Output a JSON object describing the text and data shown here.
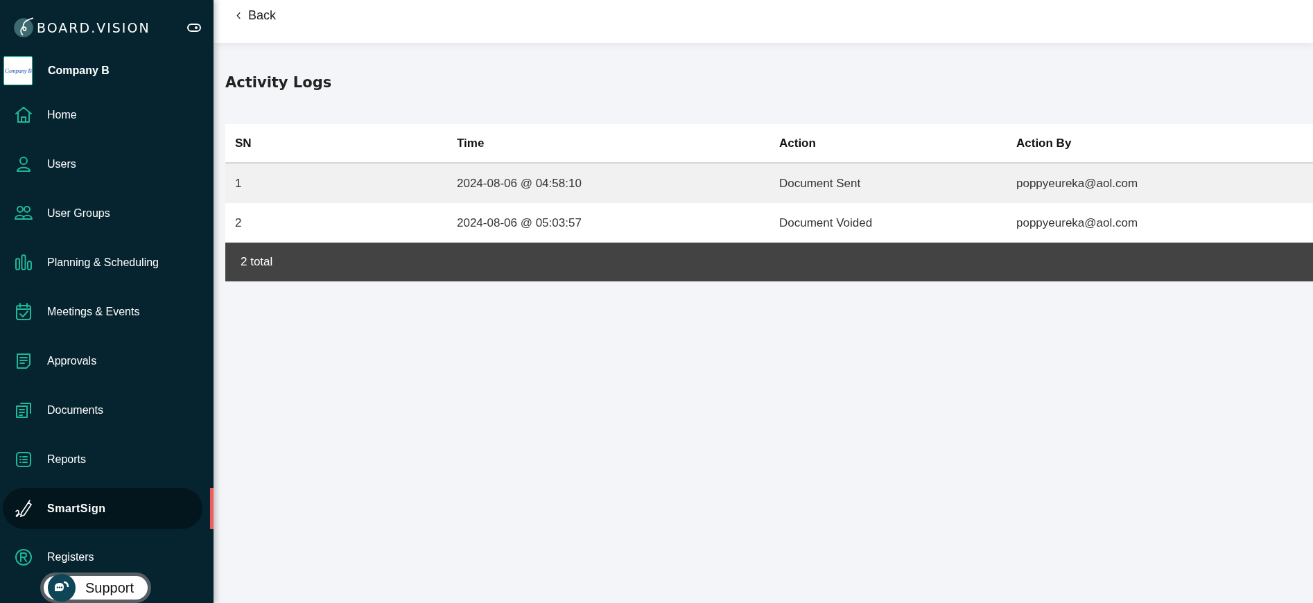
{
  "sidebar": {
    "brand": "BOARD.VISION",
    "company": {
      "logo_text": "Company B",
      "name": "Company B"
    },
    "items": [
      {
        "label": "Home",
        "kind": "home",
        "selected": false
      },
      {
        "label": "Users",
        "kind": "user",
        "selected": false
      },
      {
        "label": "User Groups",
        "kind": "users",
        "selected": false
      },
      {
        "label": "Planning & Scheduling",
        "kind": "bars",
        "selected": false
      },
      {
        "label": "Meetings & Events",
        "kind": "calendar",
        "selected": false
      },
      {
        "label": "Approvals",
        "kind": "note",
        "selected": false
      },
      {
        "label": "Documents",
        "kind": "docs",
        "selected": false
      },
      {
        "label": "Reports",
        "kind": "list",
        "selected": false
      },
      {
        "label": "SmartSign",
        "kind": "pen",
        "selected": true
      },
      {
        "label": "Registers",
        "kind": "registered",
        "selected": false
      }
    ]
  },
  "support_button": {
    "label": "Support"
  },
  "header": {
    "back": "Back"
  },
  "page_title": "Activity Logs",
  "table": {
    "columns": [
      "SN",
      "Time",
      "Action",
      "Action By"
    ],
    "rows": [
      [
        "1",
        "2024-08-06 @ 04:58:10",
        "Document Sent",
        "poppyeureka@aol.com"
      ],
      [
        "2",
        "2024-08-06 @ 05:03:57",
        "Document Voided",
        "poppyeureka@aol.com"
      ]
    ],
    "footer": "2 total"
  }
}
